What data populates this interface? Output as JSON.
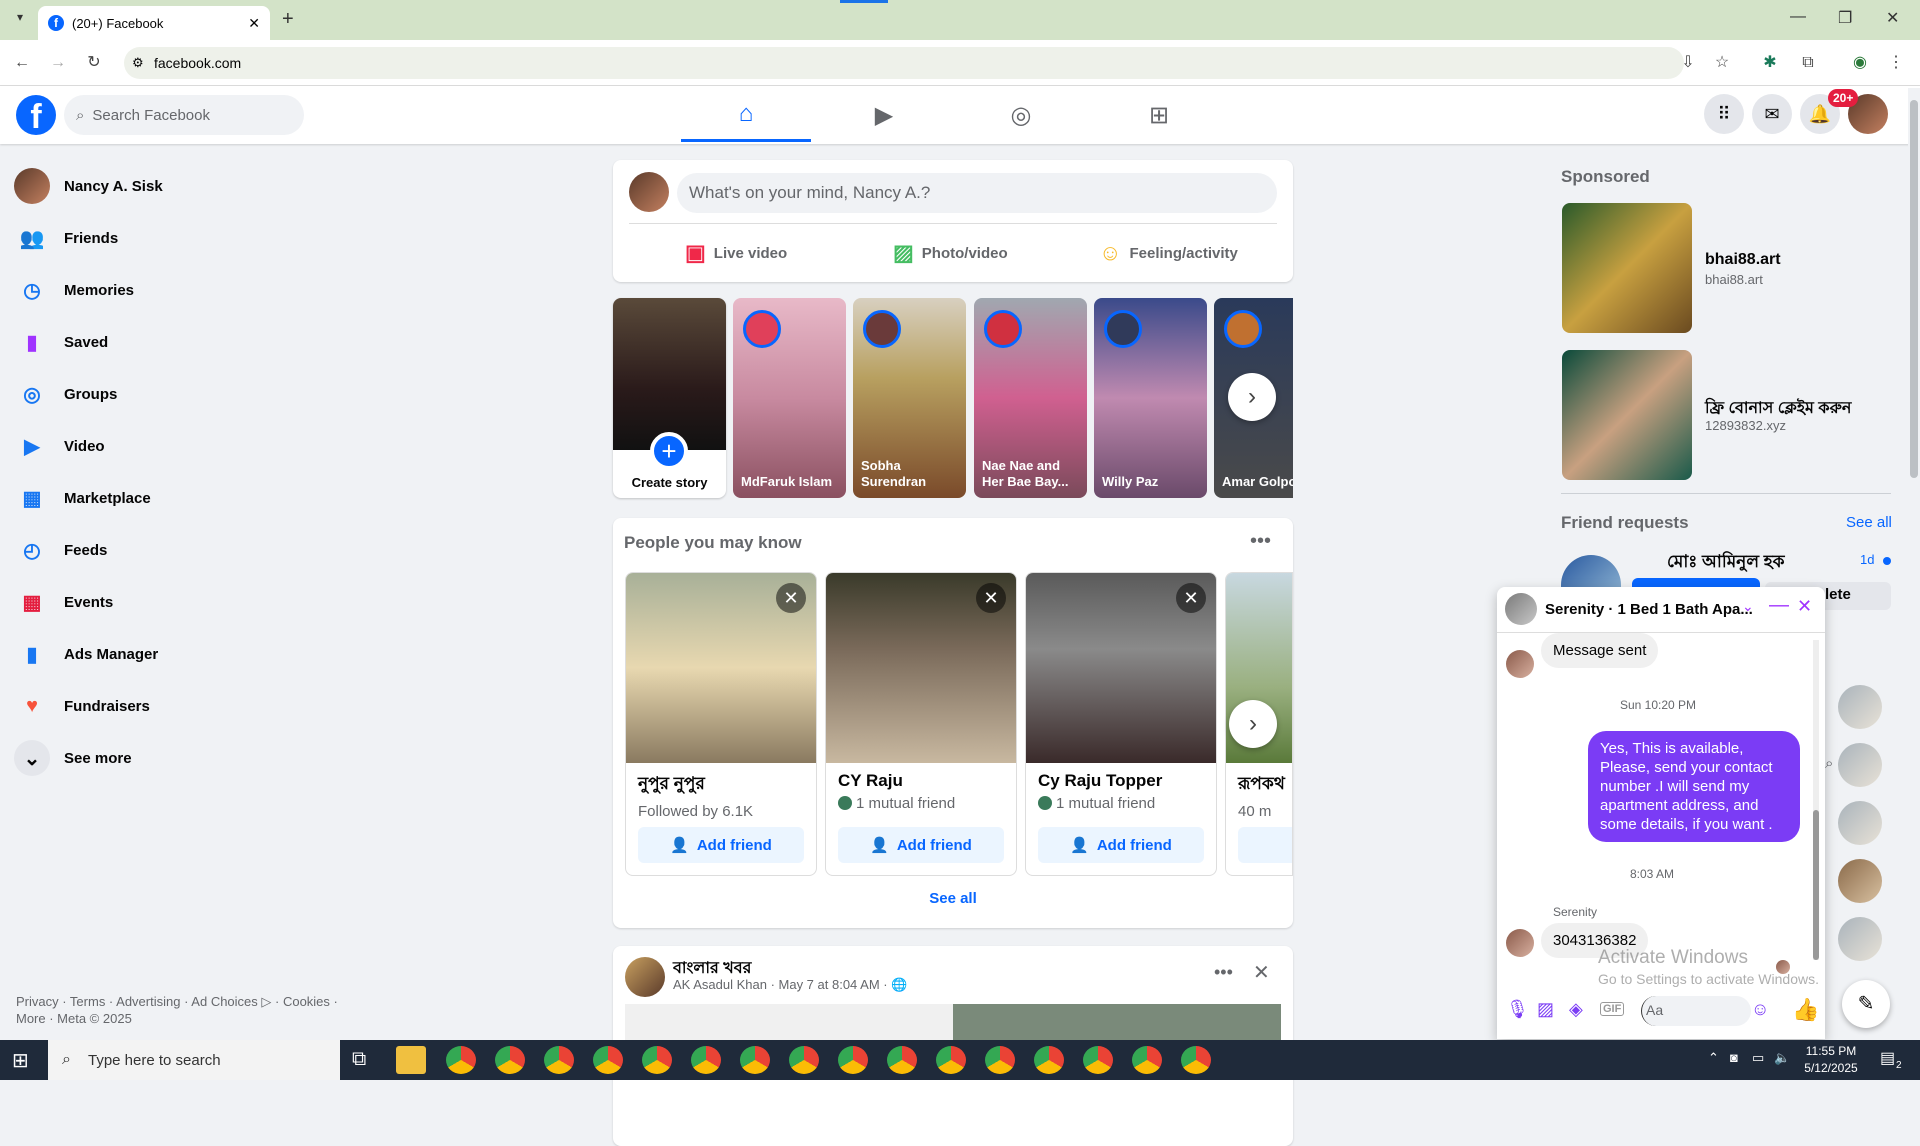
{
  "browser": {
    "tab_title": "(20+) Facebook",
    "url": "facebook.com"
  },
  "header": {
    "search_placeholder": "Search Facebook",
    "notification_badge": "20+"
  },
  "sidebar": {
    "items": [
      {
        "label": "Nancy A. Sisk",
        "icon": "avatar"
      },
      {
        "label": "Friends",
        "icon": "friends-icon"
      },
      {
        "label": "Memories",
        "icon": "clock-icon"
      },
      {
        "label": "Saved",
        "icon": "bookmark-icon"
      },
      {
        "label": "Groups",
        "icon": "groups-icon"
      },
      {
        "label": "Video",
        "icon": "video-icon"
      },
      {
        "label": "Marketplace",
        "icon": "shop-icon"
      },
      {
        "label": "Feeds",
        "icon": "feeds-icon"
      },
      {
        "label": "Events",
        "icon": "calendar-icon"
      },
      {
        "label": "Ads Manager",
        "icon": "chart-icon"
      },
      {
        "label": "Fundraisers",
        "icon": "heart-icon"
      },
      {
        "label": "See more",
        "icon": "chevron-down-icon"
      }
    ],
    "footer_line1": "Privacy · Terms · Advertising · Ad Choices ▷ · Cookies ·",
    "footer_line2": "More · Meta © 2025"
  },
  "composer": {
    "placeholder": "What's on your mind, Nancy A.?",
    "live": "Live video",
    "photo": "Photo/video",
    "feeling": "Feeling/activity"
  },
  "stories": [
    {
      "name": "Create story"
    },
    {
      "name": "MdFaruk Islam"
    },
    {
      "name": "Sobha Surendran"
    },
    {
      "name": "Nae Nae and Her Bae Bay..."
    },
    {
      "name": "Willy Paz"
    },
    {
      "name": "Amar Golpo আমার গল্প"
    }
  ],
  "pymk": {
    "title": "People you may know",
    "see_all": "See all",
    "add_label": "Add friend",
    "people": [
      {
        "name": "নুপুর নুপুর",
        "meta": "Followed by 6.1K"
      },
      {
        "name": "CY Raju",
        "meta": "1 mutual friend"
      },
      {
        "name": "Cy Raju Topper",
        "meta": "1 mutual friend"
      },
      {
        "name": "রূপকথ",
        "meta": "40 m"
      }
    ]
  },
  "post": {
    "page_name": "বাংলার খবর",
    "byline": "AK Asadul Khan · May 7 at 8:04 AM · 🌐"
  },
  "right": {
    "sponsored": "Sponsored",
    "ads": [
      {
        "title": "bhai88.art",
        "url": "bhai88.art"
      },
      {
        "title": "ফ্রি বোনাস ক্লেইম করুন",
        "url": "12893832.xyz"
      }
    ],
    "friend_requests": "Friend requests",
    "see_all": "See all",
    "request_name": "মোঃ আমিনুল হক",
    "request_age": "1d",
    "delete_label": "lete"
  },
  "chat": {
    "title": "Serenity · 1 Bed 1 Bath Apa...",
    "msg1": "Message sent",
    "time1": "Sun 10:20 PM",
    "msg2": "Yes, This is  available, Please, send your contact number .I will send my apartment address, and some details, if you want .",
    "time2": "8:03 AM",
    "sender": "Serenity",
    "msg3": "3043136382",
    "input_placeholder": "Aa",
    "watermark1": "Activate Windows",
    "watermark2": "Go to Settings to activate Windows."
  },
  "taskbar": {
    "search": "Type here to search",
    "time": "11:55 PM",
    "date": "5/12/2025",
    "notif": "2"
  }
}
